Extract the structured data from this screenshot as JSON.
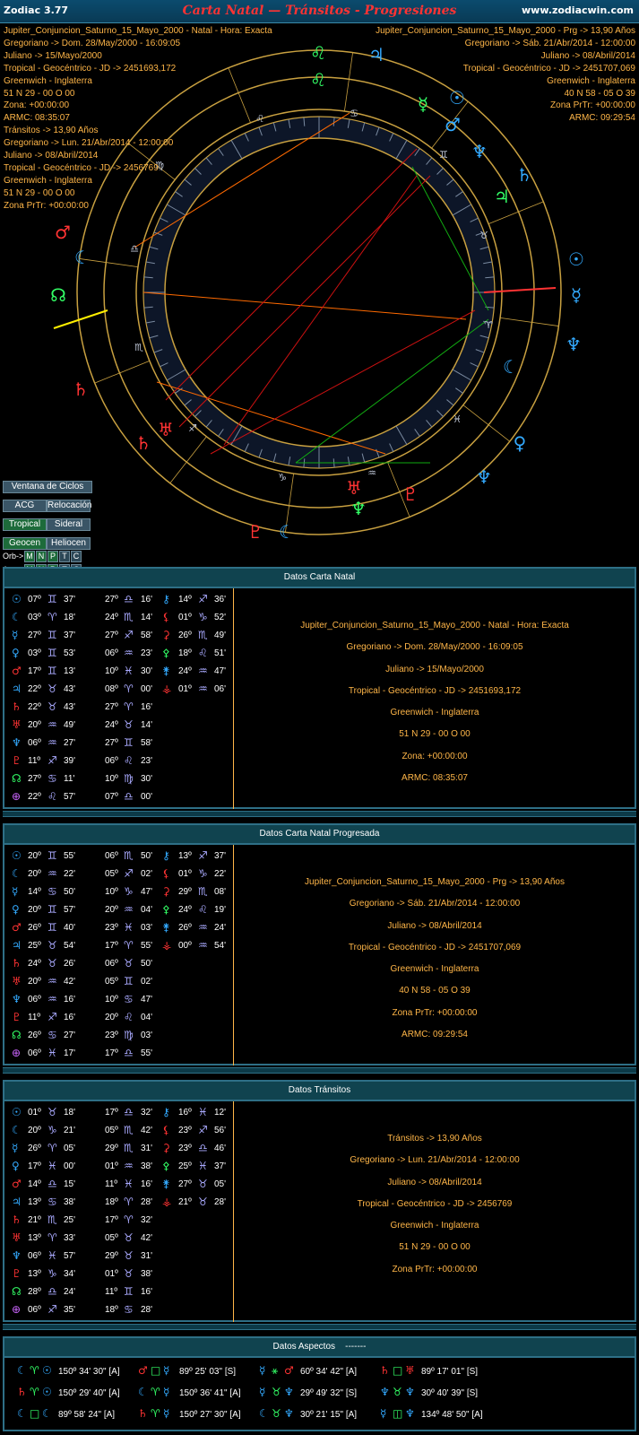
{
  "window": {
    "app_name": "Zodiac 3.77",
    "title": "Carta Natal — Tránsitos - Progresiones",
    "url": "www.zodiacwin.com"
  },
  "chart_info_left": [
    "Jupiter_Conjuncion_Saturno_15_Mayo_2000 - Natal - Hora: Exacta",
    "Gregoriano -> Dom. 28/May/2000 - 16:09:05",
    "Juliano -> 15/Mayo/2000",
    "Tropical - Geocéntrico - JD -> 2451693,172",
    "Greenwich - Inglaterra",
    "51 N 29 - 00 O 00",
    "Zona: +00:00:00",
    "ARMC: 08:35:07",
    "Tránsitos -> 13,90 Años",
    "Gregoriano -> Lun. 21/Abr/2014 - 12:00:00",
    "Juliano -> 08/Abril/2014",
    "Tropical - Geocéntrico - JD -> 2456769",
    "Greenwich - Inglaterra",
    "51 N 29 - 00 O 00",
    "Zona PrTr: +00:00:00"
  ],
  "chart_info_right": [
    "Jupiter_Conjuncion_Saturno_15_Mayo_2000 - Prg -> 13,90 Años",
    "Gregoriano -> Sáb. 21/Abr/2014 - 12:00:00",
    "Juliano -> 08/Abril/2014",
    "Tropical - Geocéntrico - JD -> 2451707,069",
    "Greenwich - Inglaterra",
    "40 N 58 - 05 O 39",
    "Zona PrTr: +00:00:00",
    "ARMC: 09:29:54"
  ],
  "controls": {
    "ventana": "Ventana de Ciclos",
    "acg": "ACG",
    "relocacion": "Relocación",
    "tropical": "Tropical",
    "sideral": "Sideral",
    "geocen": "Geocen",
    "heliocen": "Heliocen",
    "orb_label": "Orb->",
    "asp_label": "Asp->",
    "toggles": [
      "M",
      "N",
      "P",
      "T",
      "C"
    ]
  },
  "natal": {
    "title": "Datos Carta Natal",
    "left": [
      [
        "☉",
        "07º",
        "♊",
        "37'"
      ],
      [
        "☾",
        "03º",
        "♈",
        "18'"
      ],
      [
        "☿",
        "27º",
        "♊",
        "37'"
      ],
      [
        "♀",
        "03º",
        "♊",
        "53'"
      ],
      [
        "♂",
        "17º",
        "♊",
        "13'"
      ],
      [
        "♃",
        "22º",
        "♉",
        "43'"
      ],
      [
        "♄",
        "22º",
        "♉",
        "43'"
      ],
      [
        "♅",
        "20º",
        "♒",
        "49'"
      ],
      [
        "♆",
        "06º",
        "♒",
        "27'"
      ],
      [
        "♇",
        "11º",
        "♐",
        "39'"
      ],
      [
        "☊",
        "27º",
        "♋",
        "11'"
      ],
      [
        "⊕",
        "22º",
        "♌",
        "57'"
      ]
    ],
    "mid": [
      [
        "27º",
        "♎",
        "16'"
      ],
      [
        "24º",
        "♏",
        "14'"
      ],
      [
        "27º",
        "♐",
        "58'"
      ],
      [
        "06º",
        "♒",
        "23'"
      ],
      [
        "10º",
        "♓",
        "30'"
      ],
      [
        "08º",
        "♈",
        "00'"
      ],
      [
        "27º",
        "♈",
        "16'"
      ],
      [
        "24º",
        "♉",
        "14'"
      ],
      [
        "27º",
        "♊",
        "58'"
      ],
      [
        "06º",
        "♌",
        "23'"
      ],
      [
        "10º",
        "♍",
        "30'"
      ],
      [
        "07º",
        "♎",
        "00'"
      ]
    ],
    "right": [
      [
        "⚷",
        "14º",
        "♐",
        "36'"
      ],
      [
        "⚸",
        "01º",
        "♑",
        "52'"
      ],
      [
        "⚳",
        "26º",
        "♏",
        "49'"
      ],
      [
        "⚴",
        "18º",
        "♌",
        "51'"
      ],
      [
        "⚵",
        "24º",
        "♒",
        "47'"
      ],
      [
        "⚶",
        "01º",
        "♒",
        "06'"
      ]
    ],
    "info": [
      "Jupiter_Conjuncion_Saturno_15_Mayo_2000 - Natal - Hora: Exacta",
      "Gregoriano -> Dom. 28/May/2000 - 16:09:05",
      "Juliano -> 15/Mayo/2000",
      "Tropical - Geocéntrico - JD -> 2451693,172",
      "Greenwich - Inglaterra",
      "51 N 29 - 00 O 00",
      "Zona: +00:00:00",
      "ARMC: 08:35:07"
    ]
  },
  "progressed": {
    "title": "Datos Carta Natal Progresada",
    "left": [
      [
        "☉",
        "20º",
        "♊",
        "55'"
      ],
      [
        "☾",
        "20º",
        "♒",
        "22'"
      ],
      [
        "☿",
        "14º",
        "♋",
        "50'"
      ],
      [
        "♀",
        "20º",
        "♊",
        "57'"
      ],
      [
        "♂",
        "26º",
        "♊",
        "40'"
      ],
      [
        "♃",
        "25º",
        "♉",
        "54'"
      ],
      [
        "♄",
        "24º",
        "♉",
        "26'"
      ],
      [
        "♅",
        "20º",
        "♒",
        "42'"
      ],
      [
        "♆",
        "06º",
        "♒",
        "16'"
      ],
      [
        "♇",
        "11º",
        "♐",
        "16'"
      ],
      [
        "☊",
        "26º",
        "♋",
        "27'"
      ],
      [
        "⊕",
        "06º",
        "♓",
        "17'"
      ]
    ],
    "mid": [
      [
        "06º",
        "♏",
        "50'"
      ],
      [
        "05º",
        "♐",
        "02'"
      ],
      [
        "10º",
        "♑",
        "47'"
      ],
      [
        "20º",
        "♒",
        "04'"
      ],
      [
        "23º",
        "♓",
        "03'"
      ],
      [
        "17º",
        "♈",
        "55'"
      ],
      [
        "06º",
        "♉",
        "50'"
      ],
      [
        "05º",
        "♊",
        "02'"
      ],
      [
        "10º",
        "♋",
        "47'"
      ],
      [
        "20º",
        "♌",
        "04'"
      ],
      [
        "23º",
        "♍",
        "03'"
      ],
      [
        "17º",
        "♎",
        "55'"
      ]
    ],
    "right": [
      [
        "⚷",
        "13º",
        "♐",
        "37'"
      ],
      [
        "⚸",
        "01º",
        "♑",
        "22'"
      ],
      [
        "⚳",
        "29º",
        "♏",
        "08'"
      ],
      [
        "⚴",
        "24º",
        "♌",
        "19'"
      ],
      [
        "⚵",
        "26º",
        "♒",
        "24'"
      ],
      [
        "⚶",
        "00º",
        "♒",
        "54'"
      ]
    ],
    "info": [
      "Jupiter_Conjuncion_Saturno_15_Mayo_2000 - Prg -> 13,90 Años",
      "Gregoriano -> Sáb. 21/Abr/2014 - 12:00:00",
      "Juliano -> 08/Abril/2014",
      "Tropical - Geocéntrico - JD -> 2451707,069",
      "Greenwich - Inglaterra",
      "40 N 58 - 05 O 39",
      "Zona PrTr: +00:00:00",
      "ARMC: 09:29:54"
    ]
  },
  "transits": {
    "title": "Datos Tránsitos",
    "left": [
      [
        "☉",
        "01º",
        "♉",
        "18'"
      ],
      [
        "☾",
        "20º",
        "♑",
        "21'"
      ],
      [
        "☿",
        "26º",
        "♈",
        "05'"
      ],
      [
        "♀",
        "17º",
        "♓",
        "00'"
      ],
      [
        "♂",
        "14º",
        "♎",
        "15'"
      ],
      [
        "♃",
        "13º",
        "♋",
        "38'"
      ],
      [
        "♄",
        "21º",
        "♏",
        "25'"
      ],
      [
        "♅",
        "13º",
        "♈",
        "33'"
      ],
      [
        "♆",
        "06º",
        "♓",
        "57'"
      ],
      [
        "♇",
        "13º",
        "♑",
        "34'"
      ],
      [
        "☊",
        "28º",
        "♎",
        "24'"
      ],
      [
        "⊕",
        "06º",
        "♐",
        "35'"
      ]
    ],
    "mid": [
      [
        "17º",
        "♎",
        "32'"
      ],
      [
        "05º",
        "♏",
        "42'"
      ],
      [
        "29º",
        "♏",
        "31'"
      ],
      [
        "01º",
        "♒",
        "38'"
      ],
      [
        "11º",
        "♓",
        "16'"
      ],
      [
        "18º",
        "♈",
        "28'"
      ],
      [
        "17º",
        "♈",
        "32'"
      ],
      [
        "05º",
        "♉",
        "42'"
      ],
      [
        "29º",
        "♉",
        "31'"
      ],
      [
        "01º",
        "♉",
        "38'"
      ],
      [
        "11º",
        "♊",
        "16'"
      ],
      [
        "18º",
        "♋",
        "28'"
      ]
    ],
    "right": [
      [
        "⚷",
        "16º",
        "♓",
        "12'"
      ],
      [
        "⚸",
        "23º",
        "♐",
        "56'"
      ],
      [
        "⚳",
        "23º",
        "♎",
        "46'"
      ],
      [
        "⚴",
        "25º",
        "♓",
        "37'"
      ],
      [
        "⚵",
        "27º",
        "♉",
        "05'"
      ],
      [
        "⚶",
        "21º",
        "♉",
        "28'"
      ]
    ],
    "info": [
      "Tránsitos -> 13,90 Años",
      "Gregoriano -> Lun. 21/Abr/2014 - 12:00:00",
      "Juliano -> 08/Abril/2014",
      "Tropical - Geocéntrico - JD -> 2456769",
      "Greenwich - Inglaterra",
      "51 N 29 - 00 O 00",
      "Zona PrTr: +00:00:00"
    ]
  },
  "aspects": {
    "title": "Datos Aspectos",
    "title_suffix": "-------",
    "rows": [
      [
        [
          "☾",
          "♈",
          "☉",
          "150º 34' 30\" [A]"
        ],
        [
          "♂",
          "□",
          "☿",
          "89º 25' 03\" [S]"
        ],
        [
          "☿",
          "⚹",
          "♂",
          "60º 34' 42\" [A]"
        ],
        [
          "♄",
          "□",
          "♅",
          "89º 17' 01\" [S]"
        ]
      ],
      [
        [
          "♄",
          "♈",
          "☉",
          "150º 29' 40\" [A]"
        ],
        [
          "☾",
          "♈",
          "☿",
          "150º 36' 41\" [A]"
        ],
        [
          "☿",
          "♉",
          "♆",
          "29º 49' 32\" [S]"
        ],
        [
          "♆",
          "♉",
          "♆",
          "30º 40' 39\" [S]"
        ]
      ],
      [
        [
          "☾",
          "□",
          "☾",
          "89º 58' 24\" [A]"
        ],
        [
          "♄",
          "♈",
          "☿",
          "150º 27' 30\" [A]"
        ],
        [
          "☾",
          "♉",
          "♆",
          "30º 21' 15\" [A]"
        ],
        [
          "☿",
          "◫",
          "♆",
          "134º 48' 50\" [A]"
        ]
      ]
    ]
  }
}
